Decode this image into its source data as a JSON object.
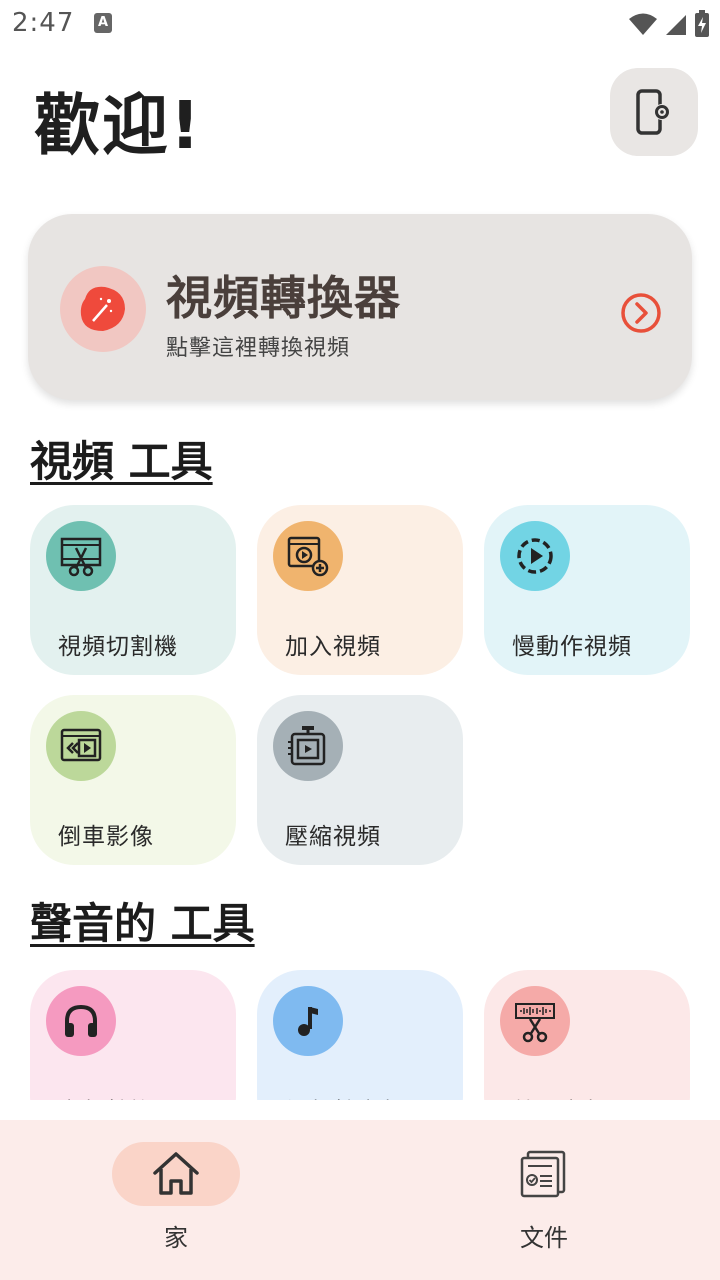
{
  "status_bar": {
    "time": "2:47",
    "notification_letter": "A"
  },
  "header": {
    "title": "歡迎!"
  },
  "converter": {
    "title": "視頻轉換器",
    "subtitle": "點擊這裡轉換視頻"
  },
  "video_tools": {
    "heading": "視頻 工具",
    "items": [
      {
        "label": "視頻切割機",
        "icon": "film-scissors-icon",
        "bg": "#e3f1ef",
        "icon_bg": "#6fc0b1"
      },
      {
        "label": "加入視頻",
        "icon": "video-add-icon",
        "bg": "#fcefe4",
        "icon_bg": "#f0b46e"
      },
      {
        "label": "慢動作視頻",
        "icon": "slow-motion-icon",
        "bg": "#e2f4f8",
        "icon_bg": "#72d4e4"
      },
      {
        "label": "倒車影像",
        "icon": "rewind-video-icon",
        "bg": "#f3f8e8",
        "icon_bg": "#bcd89a"
      },
      {
        "label": "壓縮視頻",
        "icon": "compress-video-icon",
        "bg": "#e8edef",
        "icon_bg": "#a5b0b6"
      }
    ]
  },
  "audio_tools": {
    "heading": "聲音的 工具",
    "items": [
      {
        "label": "音頻轉換器",
        "icon": "headphones-icon",
        "bg": "#fce6ef",
        "icon_bg": "#f59ac0"
      },
      {
        "label": "視頻轉音頻",
        "icon": "music-note-icon",
        "bg": "#e3effc",
        "icon_bg": "#7fbaf0"
      },
      {
        "label": "剪切音頻",
        "icon": "audio-scissors-icon",
        "bg": "#fce8e8",
        "icon_bg": "#f5aaa8"
      }
    ]
  },
  "bottom_nav": {
    "items": [
      {
        "label": "家",
        "icon": "home-icon",
        "active": true
      },
      {
        "label": "文件",
        "icon": "files-icon",
        "active": false
      }
    ]
  },
  "colors": {
    "accent": "#e8503a",
    "nav_bg": "#fcecea",
    "nav_active": "#fad4c8"
  }
}
